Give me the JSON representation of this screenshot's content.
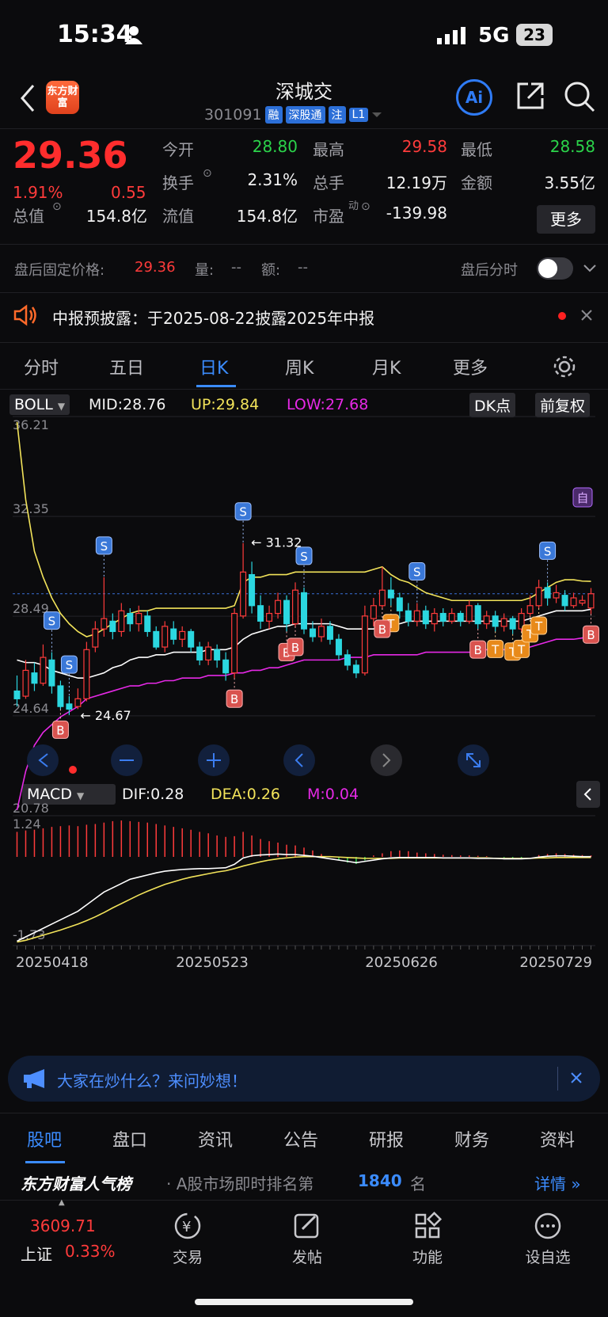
{
  "status_bar": {
    "time": "15:34",
    "network": "5G",
    "battery": "23"
  },
  "header": {
    "title": "深城交",
    "code": "301091",
    "tags": [
      "融",
      "深股通",
      "注",
      "L1"
    ],
    "logo_text": "东方财富"
  },
  "quote": {
    "price": "29.36",
    "change_pct": "1.91%",
    "change": "0.55",
    "fields": [
      {
        "label": "今开",
        "value": "28.80",
        "color": "green"
      },
      {
        "label": "最高",
        "value": "29.58",
        "color": "red"
      },
      {
        "label": "最低",
        "value": "28.58",
        "color": "green"
      },
      {
        "label": "换手",
        "value": "2.31%",
        "color": "white"
      },
      {
        "label": "总手",
        "value": "12.19万",
        "color": "white"
      },
      {
        "label": "金额",
        "value": "3.55亿",
        "color": "white"
      },
      {
        "label": "总值",
        "value": "154.8亿",
        "color": "white"
      },
      {
        "label": "流值",
        "value": "154.8亿",
        "color": "white"
      },
      {
        "label": "市盈",
        "value": "-139.98",
        "color": "white"
      }
    ],
    "pe_superscript": "动",
    "more_label": "更多"
  },
  "after_hours": {
    "label": "盘后固定价格:",
    "price": "29.36",
    "vol_label": "量:",
    "vol": "--",
    "amt_label": "额:",
    "amt": "--",
    "toggle_label": "盘后分时"
  },
  "notice": {
    "text": "中报预披露：于2025-08-22披露2025年中报"
  },
  "tabs": [
    {
      "label": "分时",
      "active": false
    },
    {
      "label": "五日",
      "active": false
    },
    {
      "label": "日K",
      "active": true
    },
    {
      "label": "周K",
      "active": false
    },
    {
      "label": "月K",
      "active": false
    },
    {
      "label": "更多",
      "active": false
    }
  ],
  "chart_data": [
    {
      "type": "candlestick",
      "indicator": "BOLL",
      "legend": {
        "mid": "MID:28.76",
        "up": "UP:29.84",
        "low": "LOW:27.68"
      },
      "buttons": {
        "dk": "DK点",
        "adj": "前复权"
      },
      "y_ticks": [
        "36.21",
        "32.35",
        "28.49",
        "24.64",
        "20.78"
      ],
      "ylim": [
        20.78,
        36.21
      ],
      "annotations": {
        "high": "31.32",
        "low": "24.67",
        "current_marker": "自"
      },
      "marker_labels": {
        "buy": "B",
        "sell": "S",
        "t": "T"
      },
      "candles": [
        [
          25.6,
          25.3,
          26.2,
          25.0
        ],
        [
          25.4,
          26.4,
          26.8,
          25.3
        ],
        [
          26.3,
          25.9,
          26.7,
          25.6
        ],
        [
          25.9,
          26.9,
          27.4,
          25.8
        ],
        [
          26.8,
          25.8,
          27.1,
          25.5
        ],
        [
          25.8,
          25.0,
          26.0,
          24.9
        ],
        [
          25.1,
          24.9,
          25.4,
          24.67
        ],
        [
          25.0,
          25.3,
          25.7,
          24.9
        ],
        [
          25.3,
          27.2,
          27.5,
          25.2
        ],
        [
          27.3,
          28.0,
          28.3,
          27.1
        ],
        [
          28.0,
          28.4,
          30.0,
          27.7
        ],
        [
          28.3,
          27.9,
          28.6,
          27.6
        ],
        [
          27.9,
          28.7,
          29.0,
          27.7
        ],
        [
          28.6,
          28.2,
          28.8,
          27.9
        ],
        [
          28.2,
          28.6,
          28.9,
          27.9
        ],
        [
          28.5,
          27.9,
          28.7,
          27.7
        ],
        [
          27.9,
          27.3,
          28.1,
          27.2
        ],
        [
          27.3,
          28.1,
          28.3,
          27.1
        ],
        [
          28.0,
          27.6,
          28.3,
          27.4
        ],
        [
          27.6,
          27.9,
          28.1,
          27.3
        ],
        [
          27.9,
          27.3,
          28.0,
          27.1
        ],
        [
          27.3,
          26.8,
          27.5,
          26.6
        ],
        [
          26.8,
          27.3,
          27.5,
          26.6
        ],
        [
          27.2,
          26.8,
          27.4,
          26.5
        ],
        [
          26.8,
          26.3,
          27.1,
          26.0
        ],
        [
          26.3,
          28.6,
          28.8,
          26.1
        ],
        [
          28.5,
          30.2,
          31.32,
          28.4
        ],
        [
          30.1,
          28.9,
          30.6,
          28.6
        ],
        [
          28.9,
          28.3,
          29.3,
          28.0
        ],
        [
          28.3,
          28.6,
          28.9,
          28.0
        ],
        [
          28.6,
          29.1,
          29.4,
          28.4
        ],
        [
          29.1,
          28.2,
          29.3,
          27.9
        ],
        [
          28.2,
          29.5,
          29.8,
          28.1
        ],
        [
          29.4,
          28.0,
          29.6,
          27.8
        ],
        [
          28.0,
          27.7,
          28.3,
          27.5
        ],
        [
          27.7,
          28.1,
          28.4,
          27.5
        ],
        [
          28.1,
          27.6,
          28.3,
          27.4
        ],
        [
          27.6,
          27.0,
          27.8,
          26.8
        ],
        [
          27.0,
          26.6,
          27.2,
          26.4
        ],
        [
          26.6,
          26.3,
          26.8,
          26.1
        ],
        [
          26.3,
          28.5,
          28.9,
          26.2
        ],
        [
          28.4,
          28.9,
          29.2,
          28.1
        ],
        [
          28.9,
          29.5,
          30.4,
          28.8
        ],
        [
          29.5,
          29.2,
          30.0,
          28.9
        ],
        [
          29.2,
          28.7,
          29.4,
          28.4
        ],
        [
          28.7,
          28.3,
          29.0,
          28.1
        ],
        [
          28.3,
          28.7,
          29.0,
          28.1
        ],
        [
          28.7,
          28.2,
          28.9,
          28.0
        ],
        [
          28.2,
          28.6,
          28.8,
          27.9
        ],
        [
          28.6,
          28.3,
          28.8,
          28.1
        ],
        [
          28.3,
          28.6,
          28.8,
          28.2
        ],
        [
          28.6,
          28.3,
          28.7,
          28.1
        ],
        [
          28.3,
          28.9,
          29.1,
          28.2
        ],
        [
          28.9,
          28.2,
          29.0,
          28.0
        ],
        [
          28.2,
          28.5,
          28.7,
          28.0
        ],
        [
          28.5,
          28.1,
          28.7,
          27.9
        ],
        [
          28.1,
          28.4,
          28.6,
          27.9
        ],
        [
          28.4,
          28.0,
          28.5,
          27.8
        ],
        [
          28.0,
          28.6,
          28.8,
          27.9
        ],
        [
          28.6,
          28.9,
          29.3,
          28.5
        ],
        [
          28.9,
          29.6,
          29.9,
          28.8
        ],
        [
          29.6,
          29.2,
          29.8,
          28.9
        ],
        [
          29.2,
          29.4,
          29.7,
          29.0
        ],
        [
          29.3,
          28.9,
          29.5,
          28.7
        ],
        [
          28.9,
          29.2,
          29.4,
          28.8
        ],
        [
          29.0,
          29.1,
          29.3,
          28.9
        ],
        [
          28.81,
          29.36,
          29.58,
          28.58
        ]
      ],
      "mid": [
        26.8,
        26.7,
        26.7,
        26.6,
        26.4,
        26.3,
        26.2,
        26.1,
        26.1,
        26.2,
        26.3,
        26.5,
        26.6,
        26.8,
        26.9,
        26.9,
        27.0,
        27.0,
        27.1,
        27.1,
        27.1,
        27.1,
        27.2,
        27.2,
        27.2,
        27.3,
        27.6,
        27.8,
        27.9,
        28.0,
        28.1,
        28.1,
        28.2,
        28.2,
        28.2,
        28.2,
        28.2,
        28.1,
        28.0,
        28.0,
        28.0,
        28.0,
        28.1,
        28.2,
        28.2,
        28.3,
        28.3,
        28.3,
        28.3,
        28.3,
        28.3,
        28.3,
        28.3,
        28.3,
        28.3,
        28.3,
        28.3,
        28.3,
        28.3,
        28.4,
        28.5,
        28.6,
        28.7,
        28.7,
        28.7,
        28.7,
        28.76
      ],
      "up": [
        36.0,
        33.0,
        31.0,
        30.0,
        29.2,
        28.6,
        28.2,
        27.9,
        27.7,
        27.8,
        28.0,
        28.2,
        28.4,
        28.6,
        28.7,
        28.7,
        28.8,
        28.8,
        28.8,
        28.8,
        28.8,
        28.8,
        28.8,
        28.8,
        28.8,
        28.9,
        29.8,
        30.0,
        30.0,
        30.1,
        30.1,
        30.1,
        30.2,
        30.2,
        30.2,
        30.2,
        30.2,
        30.2,
        30.2,
        30.2,
        30.2,
        30.3,
        30.4,
        30.1,
        29.9,
        29.8,
        29.6,
        29.4,
        29.3,
        29.2,
        29.1,
        29.1,
        29.1,
        29.1,
        29.1,
        29.1,
        29.1,
        29.1,
        29.1,
        29.2,
        29.4,
        29.6,
        29.8,
        29.9,
        29.9,
        29.85,
        29.84
      ],
      "low": [
        21.0,
        22.5,
        23.5,
        24.0,
        24.3,
        24.6,
        24.8,
        25.0,
        25.3,
        25.4,
        25.5,
        25.6,
        25.7,
        25.8,
        25.8,
        25.9,
        25.9,
        26.0,
        26.0,
        26.1,
        26.1,
        26.1,
        26.2,
        26.2,
        26.2,
        26.3,
        26.3,
        26.4,
        26.4,
        26.5,
        26.5,
        26.6,
        26.7,
        26.8,
        26.8,
        26.8,
        26.8,
        26.8,
        26.9,
        26.9,
        26.9,
        27.0,
        27.0,
        27.0,
        27.0,
        27.0,
        27.0,
        27.1,
        27.1,
        27.1,
        27.1,
        27.1,
        27.1,
        27.1,
        27.2,
        27.2,
        27.2,
        27.2,
        27.2,
        27.3,
        27.4,
        27.5,
        27.6,
        27.6,
        27.6,
        27.65,
        27.68
      ],
      "markers": [
        {
          "i": 4,
          "type": "S"
        },
        {
          "i": 6,
          "type": "S"
        },
        {
          "i": 5,
          "type": "B"
        },
        {
          "i": 10,
          "type": "S"
        },
        {
          "i": 25,
          "type": "B"
        },
        {
          "i": 26,
          "type": "S"
        },
        {
          "i": 31,
          "type": "B"
        },
        {
          "i": 32,
          "type": "B"
        },
        {
          "i": 33,
          "type": "S"
        },
        {
          "i": 43,
          "type": "T"
        },
        {
          "i": 42,
          "type": "B"
        },
        {
          "i": 46,
          "type": "S"
        },
        {
          "i": 53,
          "type": "B"
        },
        {
          "i": 55,
          "type": "T"
        },
        {
          "i": 57,
          "type": "T"
        },
        {
          "i": 58,
          "type": "T"
        },
        {
          "i": 59,
          "type": "T"
        },
        {
          "i": 60,
          "type": "T"
        },
        {
          "i": 61,
          "type": "S"
        },
        {
          "i": 66,
          "type": "B"
        }
      ]
    },
    {
      "type": "bar",
      "indicator": "MACD",
      "legend": {
        "dif": "DIF:0.28",
        "dea": "DEA:0.26",
        "m": "M:0.04"
      },
      "y_ticks": [
        "1.24",
        "-1.73"
      ],
      "ylim": [
        -1.73,
        1.24
      ],
      "x_ticks": [
        "20250418",
        "20250523",
        "20250626",
        "20250729"
      ],
      "hist": [
        0.7,
        0.74,
        0.76,
        0.8,
        0.84,
        0.86,
        0.88,
        0.86,
        0.9,
        0.92,
        0.96,
        1.0,
        1.02,
        1.0,
        0.98,
        0.96,
        0.92,
        0.88,
        0.84,
        0.8,
        0.76,
        0.7,
        0.66,
        0.6,
        0.56,
        0.58,
        0.7,
        0.6,
        0.5,
        0.44,
        0.4,
        0.34,
        0.32,
        0.26,
        0.18,
        0.08,
        0.0,
        -0.08,
        -0.16,
        -0.2,
        -0.1,
        0.04,
        0.1,
        0.16,
        0.18,
        0.16,
        0.12,
        0.1,
        0.08,
        0.06,
        0.05,
        0.04,
        0.04,
        0.03,
        0.02,
        0.0,
        -0.02,
        -0.04,
        -0.03,
        0.0,
        0.05,
        0.08,
        0.1,
        0.08,
        0.06,
        0.05,
        0.04
      ],
      "dif": [
        -1.7,
        -1.6,
        -1.5,
        -1.4,
        -1.3,
        -1.2,
        -1.1,
        -1.0,
        -0.85,
        -0.7,
        -0.55,
        -0.45,
        -0.35,
        -0.25,
        -0.2,
        -0.15,
        -0.1,
        -0.06,
        -0.04,
        -0.02,
        -0.01,
        0.0,
        0.0,
        0.01,
        0.02,
        0.1,
        0.25,
        0.3,
        0.32,
        0.33,
        0.34,
        0.33,
        0.33,
        0.31,
        0.29,
        0.26,
        0.23,
        0.2,
        0.17,
        0.14,
        0.17,
        0.2,
        0.23,
        0.25,
        0.26,
        0.26,
        0.26,
        0.26,
        0.26,
        0.25,
        0.25,
        0.25,
        0.25,
        0.24,
        0.24,
        0.24,
        0.23,
        0.23,
        0.23,
        0.24,
        0.27,
        0.29,
        0.3,
        0.3,
        0.29,
        0.28,
        0.28
      ],
      "dea": [
        -1.72,
        -1.68,
        -1.62,
        -1.56,
        -1.5,
        -1.44,
        -1.37,
        -1.3,
        -1.22,
        -1.13,
        -1.03,
        -0.92,
        -0.82,
        -0.72,
        -0.62,
        -0.53,
        -0.45,
        -0.37,
        -0.31,
        -0.25,
        -0.2,
        -0.16,
        -0.12,
        -0.08,
        -0.05,
        0.0,
        0.06,
        0.11,
        0.16,
        0.2,
        0.23,
        0.25,
        0.27,
        0.28,
        0.28,
        0.28,
        0.28,
        0.27,
        0.26,
        0.25,
        0.24,
        0.24,
        0.24,
        0.24,
        0.25,
        0.25,
        0.25,
        0.25,
        0.25,
        0.25,
        0.25,
        0.25,
        0.25,
        0.25,
        0.25,
        0.24,
        0.24,
        0.24,
        0.24,
        0.24,
        0.25,
        0.25,
        0.26,
        0.26,
        0.26,
        0.26,
        0.26
      ]
    }
  ],
  "ask_bar": {
    "text": "大家在炒什么？来问妙想！"
  },
  "sub_tabs": [
    "股吧",
    "盘口",
    "资讯",
    "公告",
    "研报",
    "财务",
    "资料"
  ],
  "rank": {
    "brand": "东方财富人气榜",
    "text": "· A股市场即时排名第",
    "rank": "1840",
    "unit": "名",
    "link": "详情"
  },
  "bottom_nav": {
    "index_value": "3609.71",
    "index_name": "上证",
    "index_change": "0.33%",
    "items": [
      "交易",
      "发帖",
      "功能",
      "设自选"
    ]
  },
  "colors": {
    "up": "#ff3b3b",
    "down": "#2bd7e0",
    "mid": "#ffffff",
    "upper": "#f2e35a",
    "lower": "#e629e6",
    "accent": "#3b8cff"
  }
}
